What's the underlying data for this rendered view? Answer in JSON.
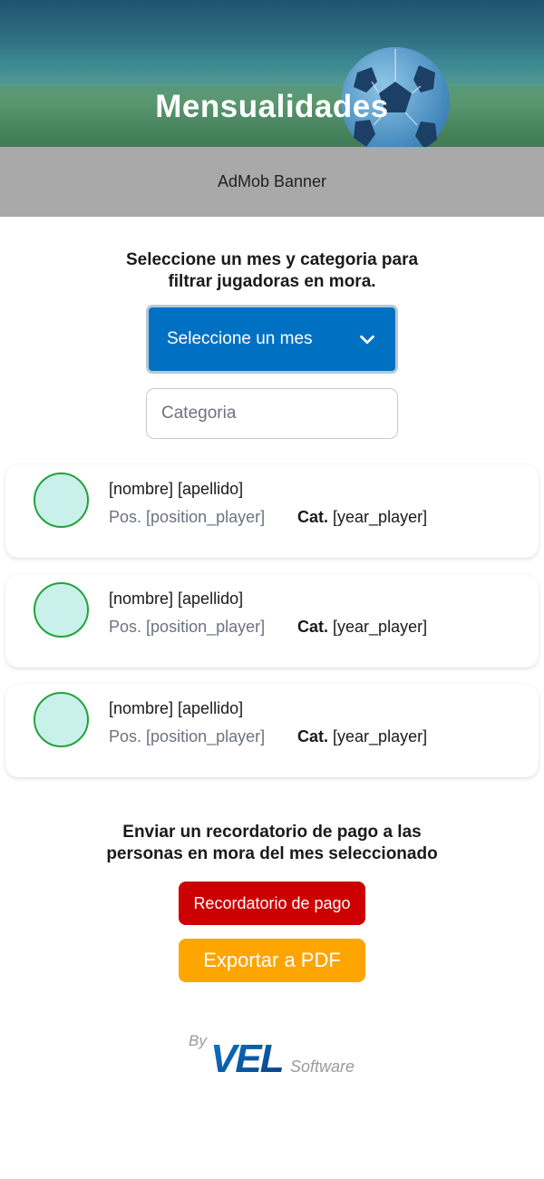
{
  "header": {
    "title": "Mensualidades",
    "background_icon": "soccer-ball-icon"
  },
  "ad_banner": {
    "label": "AdMob Banner"
  },
  "filter": {
    "instruction_line1": "Seleccione un mes y categoria para",
    "instruction_line2": "filtrar jugadoras en mora.",
    "month_select_label": "Seleccione un mes",
    "month_select_icon": "chevron-down-icon",
    "category_placeholder": "Categoria",
    "accent_color": "#0071c2"
  },
  "players": [
    {
      "name": "[nombre] [apellido]",
      "position_label": "Pos.",
      "position": "[position_player]",
      "category_label": "Cat.",
      "category": "[year_player]"
    },
    {
      "name": "[nombre] [apellido]",
      "position_label": "Pos.",
      "position": "[position_player]",
      "category_label": "Cat.",
      "category": "[year_player]"
    },
    {
      "name": "[nombre] [apellido]",
      "position_label": "Pos.",
      "position": "[position_player]",
      "category_label": "Cat.",
      "category": "[year_player]"
    }
  ],
  "reminder": {
    "text_line1": "Enviar un recordatorio de pago a las",
    "text_line2": "personas en mora del mes seleccionado",
    "reminder_button": "Recordatorio de pago",
    "reminder_color": "#cc0000",
    "export_button": "Exportar a PDF",
    "export_color": "#ffa500"
  },
  "footer": {
    "by": "By",
    "brand": "VEL",
    "suffix": "Software"
  }
}
